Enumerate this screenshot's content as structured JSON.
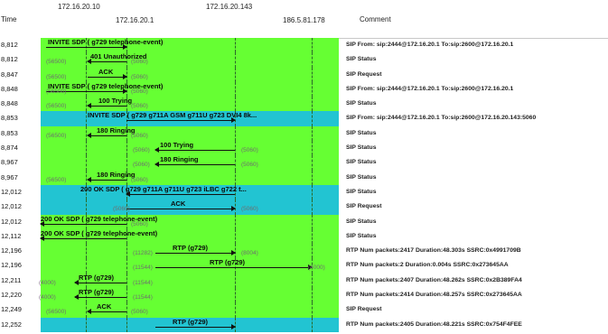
{
  "header": {
    "time": "Time",
    "hosts": [
      "172.16.20.10",
      "172.16.20.1",
      "172.16.20.143",
      "186.5.81.178"
    ],
    "comment": "Comment"
  },
  "colors": {
    "green": "#66ff33",
    "cyan": "#22c4d2"
  },
  "rows": [
    {
      "time": "8,812",
      "label": "INVITE SDP ( g729 telephone-event)",
      "port_left": "",
      "port_right": "",
      "comment": "SIP From: sip:2444@172.16.20.1 To:sip:2600@172.16.20.1"
    },
    {
      "time": "8,812",
      "label": "401 Unauthorized",
      "port_left": "(56500)",
      "port_right": "(5060)",
      "comment": "SIP Status"
    },
    {
      "time": "8,847",
      "label": "ACK",
      "port_left": "(56500)",
      "port_right": "(5060)",
      "comment": "SIP Request"
    },
    {
      "time": "8,848",
      "label": "INVITE SDP ( g729 telephone-event)",
      "port_left": "(56500)",
      "port_right": "(5060)",
      "comment": "SIP From: sip:2444@172.16.20.1 To:sip:2600@172.16.20.1"
    },
    {
      "time": "8,848",
      "label": "100 Trying",
      "port_left": "(56500)",
      "port_right": "(5060)",
      "comment": "SIP Status"
    },
    {
      "time": "8,853",
      "label": "INVITE SDP ( g729 g711A GSM g711U g723 DVI4 8k...",
      "port_left": "",
      "port_right": "",
      "comment": "SIP From: sip:2444@172.16.20.1 To:sip:2600@172.16.20.143:5060"
    },
    {
      "time": "8,853",
      "label": "180 Ringing",
      "port_left": "(56500)",
      "port_right": "(5060)",
      "comment": "SIP Status"
    },
    {
      "time": "8,874",
      "label": "100 Trying",
      "port_left": "(5060)",
      "port_right": "(5060)",
      "comment": "SIP Status"
    },
    {
      "time": "8,967",
      "label": "180 Ringing",
      "port_left": "(5060)",
      "port_right": "(5060)",
      "comment": "SIP Status"
    },
    {
      "time": "8,967",
      "label": "180 Ringing",
      "port_left": "(56500)",
      "port_right": "(5060)",
      "comment": "SIP Status"
    },
    {
      "time": "12,012",
      "label": "200 OK SDP ( g729 g711A g711U g723 iLBC g722 t...",
      "port_left": "",
      "port_right": "",
      "comment": "SIP Status"
    },
    {
      "time": "12,012",
      "label": "ACK",
      "port_left": "(5060)",
      "port_right": "(5060)",
      "comment": "SIP Request"
    },
    {
      "time": "12,012",
      "label": "200 OK SDP ( g729 telephone-event)",
      "port_left": "",
      "port_right": "(5060)",
      "comment": "SIP Status"
    },
    {
      "time": "12,112",
      "label": "200 OK SDP ( g729 telephone-event)",
      "port_left": "",
      "port_right": "",
      "comment": "SIP Status"
    },
    {
      "time": "12,196",
      "label": "RTP (g729)",
      "port_left": "(11282)",
      "port_right": "(8004)",
      "comment": "RTP Num packets:2417  Duration:48.303s SSRC:0x4991709B"
    },
    {
      "time": "12,196",
      "label": "RTP (g729)",
      "port_left": "(11544)",
      "port_right": "(4000)",
      "comment": "RTP Num packets:2  Duration:0.004s SSRC:0x273645AA"
    },
    {
      "time": "12,211",
      "label": "RTP (g729)",
      "port_left": "(4000)",
      "port_right": "(11544)",
      "comment": "RTP Num packets:2407  Duration:48.262s SSRC:0x2B389FA4"
    },
    {
      "time": "12,220",
      "label": "RTP (g729)",
      "port_left": "(4000)",
      "port_right": "(11544)",
      "comment": "RTP Num packets:2414  Duration:48.257s SSRC:0x273645AA"
    },
    {
      "time": "12,249",
      "label": "ACK",
      "port_left": "(56500)",
      "port_right": "(5060)",
      "comment": "SIP Request"
    },
    {
      "time": "12,252",
      "label": "RTP (g729)",
      "port_left": "",
      "port_right": "",
      "comment": "RTP Num packets:2405  Duration:48.221s SSRC:0x754F4FEE"
    }
  ]
}
